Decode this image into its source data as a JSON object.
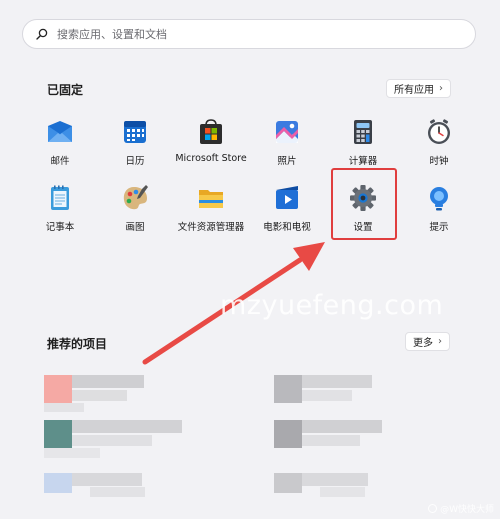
{
  "search": {
    "placeholder": "搜索应用、设置和文档",
    "icon": "search-icon"
  },
  "pinned": {
    "title": "已固定",
    "all_apps_label": "所有应用",
    "apps": [
      {
        "label": "邮件",
        "icon": "mail-icon"
      },
      {
        "label": "日历",
        "icon": "calendar-icon"
      },
      {
        "label": "Microsoft Store",
        "icon": "store-icon"
      },
      {
        "label": "照片",
        "icon": "photos-icon"
      },
      {
        "label": "计算器",
        "icon": "calculator-icon"
      },
      {
        "label": "时钟",
        "icon": "clock-icon"
      },
      {
        "label": "记事本",
        "icon": "notepad-icon"
      },
      {
        "label": "画图",
        "icon": "paint-icon"
      },
      {
        "label": "文件资源管理器",
        "icon": "folder-icon"
      },
      {
        "label": "电影和电视",
        "icon": "movies-icon"
      },
      {
        "label": "设置",
        "icon": "gear-icon"
      },
      {
        "label": "提示",
        "icon": "tips-icon"
      }
    ]
  },
  "recommended": {
    "title": "推荐的项目",
    "more_label": "更多"
  },
  "watermark": {
    "text": "mzyuefeng.com",
    "corner_text": "@W快快大师"
  },
  "colors": {
    "highlight": "#e03e3e",
    "accent": "#0a6cd4",
    "background": "#f2f2f5"
  }
}
